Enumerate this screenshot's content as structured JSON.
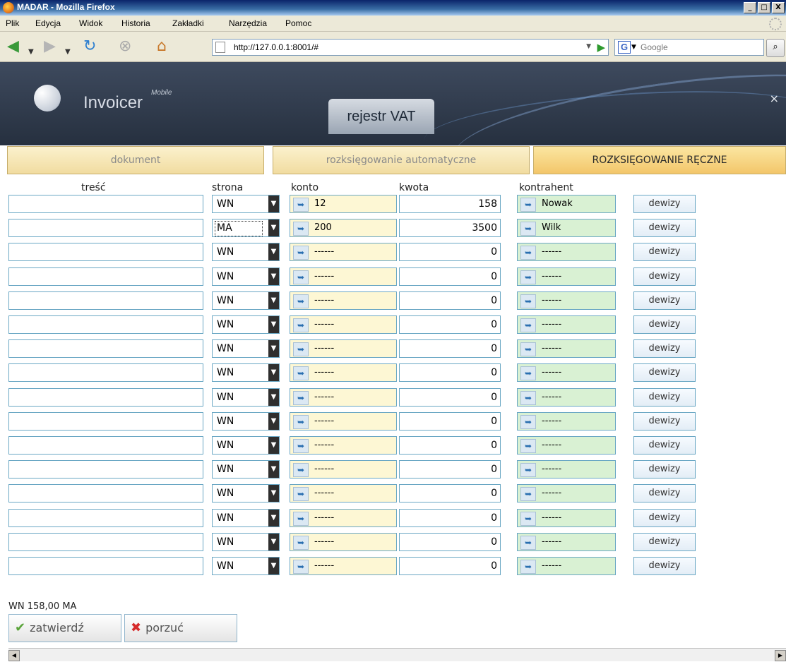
{
  "window": {
    "title": "MADAR - Mozilla Firefox",
    "buttons": [
      "_",
      "□",
      "X"
    ]
  },
  "menu": [
    "Plik",
    "Edycja",
    "Widok",
    "Historia",
    "Zakładki",
    "Narzędzia",
    "Pomoc"
  ],
  "nav": {
    "url": "http://127.0.0.1:8001/#",
    "search_placeholder": "Google",
    "search_engine_letter": "G"
  },
  "app": {
    "logo": "Invoicer",
    "logo_sup": "Mobile",
    "tab": "rejestr VAT",
    "close": "×"
  },
  "sections": [
    {
      "label": "dokument"
    },
    {
      "label": "rozksięgowanie automatyczne"
    },
    {
      "label": "ROZKSIĘGOWANIE RĘCZNE"
    }
  ],
  "columns": {
    "tresc": "treść",
    "strona": "strona",
    "konto": "konto",
    "kwota": "kwota",
    "kontrahent": "kontrahent"
  },
  "rows": [
    {
      "tresc": "",
      "strona": "WN",
      "konto": "12",
      "kwota": "158",
      "kontrahent": "Nowak"
    },
    {
      "tresc": "",
      "strona": "MA",
      "konto": "200",
      "kwota": "3500",
      "kontrahent": "Wilk"
    },
    {
      "tresc": "",
      "strona": "WN",
      "konto": "------",
      "kwota": "0",
      "kontrahent": "------"
    },
    {
      "tresc": "",
      "strona": "WN",
      "konto": "------",
      "kwota": "0",
      "kontrahent": "------"
    },
    {
      "tresc": "",
      "strona": "WN",
      "konto": "------",
      "kwota": "0",
      "kontrahent": "------"
    },
    {
      "tresc": "",
      "strona": "WN",
      "konto": "------",
      "kwota": "0",
      "kontrahent": "------"
    },
    {
      "tresc": "",
      "strona": "WN",
      "konto": "------",
      "kwota": "0",
      "kontrahent": "------"
    },
    {
      "tresc": "",
      "strona": "WN",
      "konto": "------",
      "kwota": "0",
      "kontrahent": "------"
    },
    {
      "tresc": "",
      "strona": "WN",
      "konto": "------",
      "kwota": "0",
      "kontrahent": "------"
    },
    {
      "tresc": "",
      "strona": "WN",
      "konto": "------",
      "kwota": "0",
      "kontrahent": "------"
    },
    {
      "tresc": "",
      "strona": "WN",
      "konto": "------",
      "kwota": "0",
      "kontrahent": "------"
    },
    {
      "tresc": "",
      "strona": "WN",
      "konto": "------",
      "kwota": "0",
      "kontrahent": "------"
    },
    {
      "tresc": "",
      "strona": "WN",
      "konto": "------",
      "kwota": "0",
      "kontrahent": "------"
    },
    {
      "tresc": "",
      "strona": "WN",
      "konto": "------",
      "kwota": "0",
      "kontrahent": "------"
    },
    {
      "tresc": "",
      "strona": "WN",
      "konto": "------",
      "kwota": "0",
      "kontrahent": "------"
    },
    {
      "tresc": "",
      "strona": "WN",
      "konto": "------",
      "kwota": "0",
      "kontrahent": "------"
    }
  ],
  "dewizy_label": "dewizy",
  "summary": "WN 158,00 MA",
  "actions": {
    "confirm": "zatwierdź",
    "discard": "porzuć"
  }
}
